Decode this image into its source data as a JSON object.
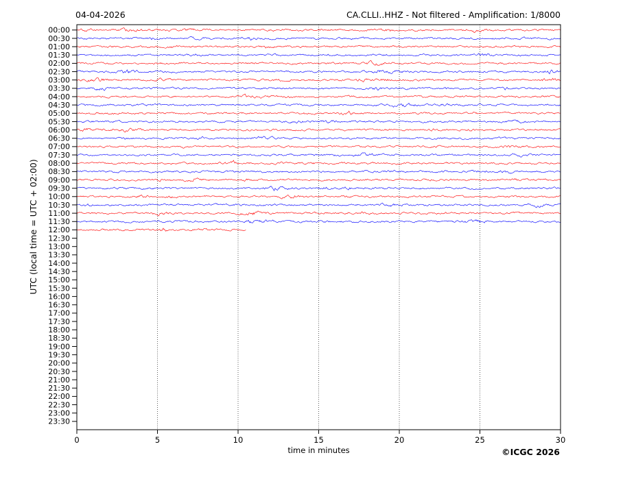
{
  "header": {
    "date": "04-04-2026",
    "title": "CA.CLLI..HHZ - Not filtered - Amplification: 1/8000"
  },
  "footer": {
    "copyright": "©ICGC 2026"
  },
  "chart_data": {
    "type": "line",
    "subtype": "helicorder-seismogram",
    "title": "CA.CLLI..HHZ - Not filtered - Amplification: 1/8000",
    "date_label": "04-04-2026",
    "xlabel": "time in minutes",
    "ylabel": "UTC (local time = UTC + 02:00)",
    "xlim": [
      0,
      30
    ],
    "x_ticks": [
      0,
      5,
      10,
      15,
      20,
      25,
      30
    ],
    "y_tick_labels": [
      "00:00",
      "00:30",
      "01:00",
      "01:30",
      "02:00",
      "02:30",
      "03:00",
      "03:30",
      "04:00",
      "04:30",
      "05:00",
      "05:30",
      "06:00",
      "06:30",
      "07:00",
      "07:30",
      "08:00",
      "08:30",
      "09:00",
      "09:30",
      "10:00",
      "10:30",
      "11:00",
      "11:30",
      "12:00",
      "12:30",
      "13:00",
      "13:30",
      "14:00",
      "14:30",
      "15:00",
      "15:30",
      "16:00",
      "16:30",
      "17:00",
      "17:30",
      "18:00",
      "18:30",
      "19:00",
      "19:30",
      "20:00",
      "20:30",
      "21:00",
      "21:30",
      "22:00",
      "22:30",
      "23:00",
      "23:30"
    ],
    "grid": {
      "vertical_dotted_lines_at_minutes": [
        5,
        10,
        15,
        20,
        25
      ]
    },
    "trace_colors": {
      "even_rows": "#ff0000",
      "odd_rows": "#0000ff"
    },
    "traces_note": "Continuous background-noise traces; no large events. Recording stops during the 12:00 row at about 10.5 minutes.",
    "traces": [
      {
        "time": "00:00",
        "color": "#ff0000",
        "start_min": 0,
        "end_min": 30
      },
      {
        "time": "00:30",
        "color": "#0000ff",
        "start_min": 0,
        "end_min": 30
      },
      {
        "time": "01:00",
        "color": "#ff0000",
        "start_min": 0,
        "end_min": 30
      },
      {
        "time": "01:30",
        "color": "#0000ff",
        "start_min": 0,
        "end_min": 30
      },
      {
        "time": "02:00",
        "color": "#ff0000",
        "start_min": 0,
        "end_min": 30
      },
      {
        "time": "02:30",
        "color": "#0000ff",
        "start_min": 0,
        "end_min": 30
      },
      {
        "time": "03:00",
        "color": "#ff0000",
        "start_min": 0,
        "end_min": 30
      },
      {
        "time": "03:30",
        "color": "#0000ff",
        "start_min": 0,
        "end_min": 30
      },
      {
        "time": "04:00",
        "color": "#ff0000",
        "start_min": 0,
        "end_min": 30
      },
      {
        "time": "04:30",
        "color": "#0000ff",
        "start_min": 0,
        "end_min": 30
      },
      {
        "time": "05:00",
        "color": "#ff0000",
        "start_min": 0,
        "end_min": 30
      },
      {
        "time": "05:30",
        "color": "#0000ff",
        "start_min": 0,
        "end_min": 30
      },
      {
        "time": "06:00",
        "color": "#ff0000",
        "start_min": 0,
        "end_min": 30
      },
      {
        "time": "06:30",
        "color": "#0000ff",
        "start_min": 0,
        "end_min": 30
      },
      {
        "time": "07:00",
        "color": "#ff0000",
        "start_min": 0,
        "end_min": 30
      },
      {
        "time": "07:30",
        "color": "#0000ff",
        "start_min": 0,
        "end_min": 30
      },
      {
        "time": "08:00",
        "color": "#ff0000",
        "start_min": 0,
        "end_min": 30
      },
      {
        "time": "08:30",
        "color": "#0000ff",
        "start_min": 0,
        "end_min": 30
      },
      {
        "time": "09:00",
        "color": "#ff0000",
        "start_min": 0,
        "end_min": 30
      },
      {
        "time": "09:30",
        "color": "#0000ff",
        "start_min": 0,
        "end_min": 30
      },
      {
        "time": "10:00",
        "color": "#ff0000",
        "start_min": 0,
        "end_min": 30
      },
      {
        "time": "10:30",
        "color": "#0000ff",
        "start_min": 0,
        "end_min": 30
      },
      {
        "time": "11:00",
        "color": "#ff0000",
        "start_min": 0,
        "end_min": 30
      },
      {
        "time": "11:30",
        "color": "#0000ff",
        "start_min": 0,
        "end_min": 30
      },
      {
        "time": "12:00",
        "color": "#ff0000",
        "start_min": 0,
        "end_min": 10.5
      }
    ]
  }
}
